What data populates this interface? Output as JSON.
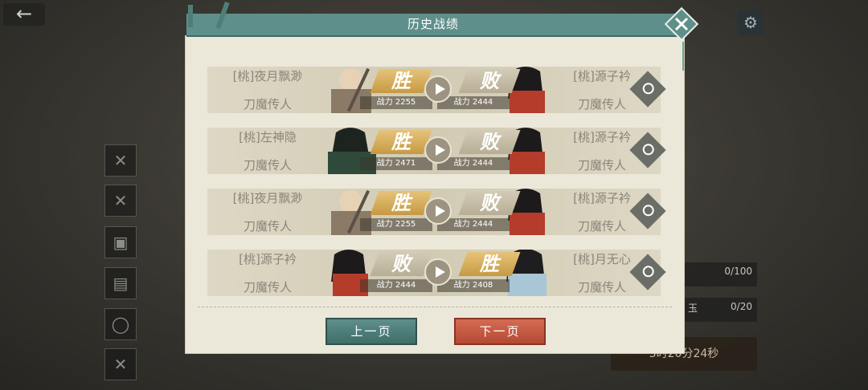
{
  "header": {
    "title": "历史战绩"
  },
  "records": [
    {
      "left_name": "[桃]夜月飘渺",
      "left_title": "刀魔传人",
      "left_result": "胜",
      "left_power": "战力 2255",
      "right_name": "[桃]源子衿",
      "right_title": "刀魔传人",
      "right_result": "败",
      "right_power": "战力 2444"
    },
    {
      "left_name": "[桃]左神隐",
      "left_title": "刀魔传人",
      "left_result": "胜",
      "left_power": "战力 2471",
      "right_name": "[桃]源子衿",
      "right_title": "刀魔传人",
      "right_result": "败",
      "right_power": "战力 2444"
    },
    {
      "left_name": "[桃]夜月飘渺",
      "left_title": "刀魔传人",
      "left_result": "胜",
      "left_power": "战力 2255",
      "right_name": "[桃]源子衿",
      "right_title": "刀魔传人",
      "right_result": "败",
      "right_power": "战力 2444"
    },
    {
      "left_name": "[桃]源子衿",
      "left_title": "刀魔传人",
      "left_result": "败",
      "left_power": "战力 2444",
      "right_name": "[桃]月无心",
      "right_title": "刀魔传人",
      "right_result": "胜",
      "right_power": "战力 2408"
    }
  ],
  "buttons": {
    "prev": "上一页",
    "next": "下一页"
  },
  "background": {
    "bar1_value": "0/100",
    "bar2_value": "0/20",
    "bar2_label": "玉",
    "timer": "5时20分24秒"
  },
  "colors": {
    "win": "#c69a42",
    "lose": "#b8ae95",
    "header": "#5f8f8a",
    "prev_button": "#3f6e69",
    "next_button": "#b44a34"
  }
}
